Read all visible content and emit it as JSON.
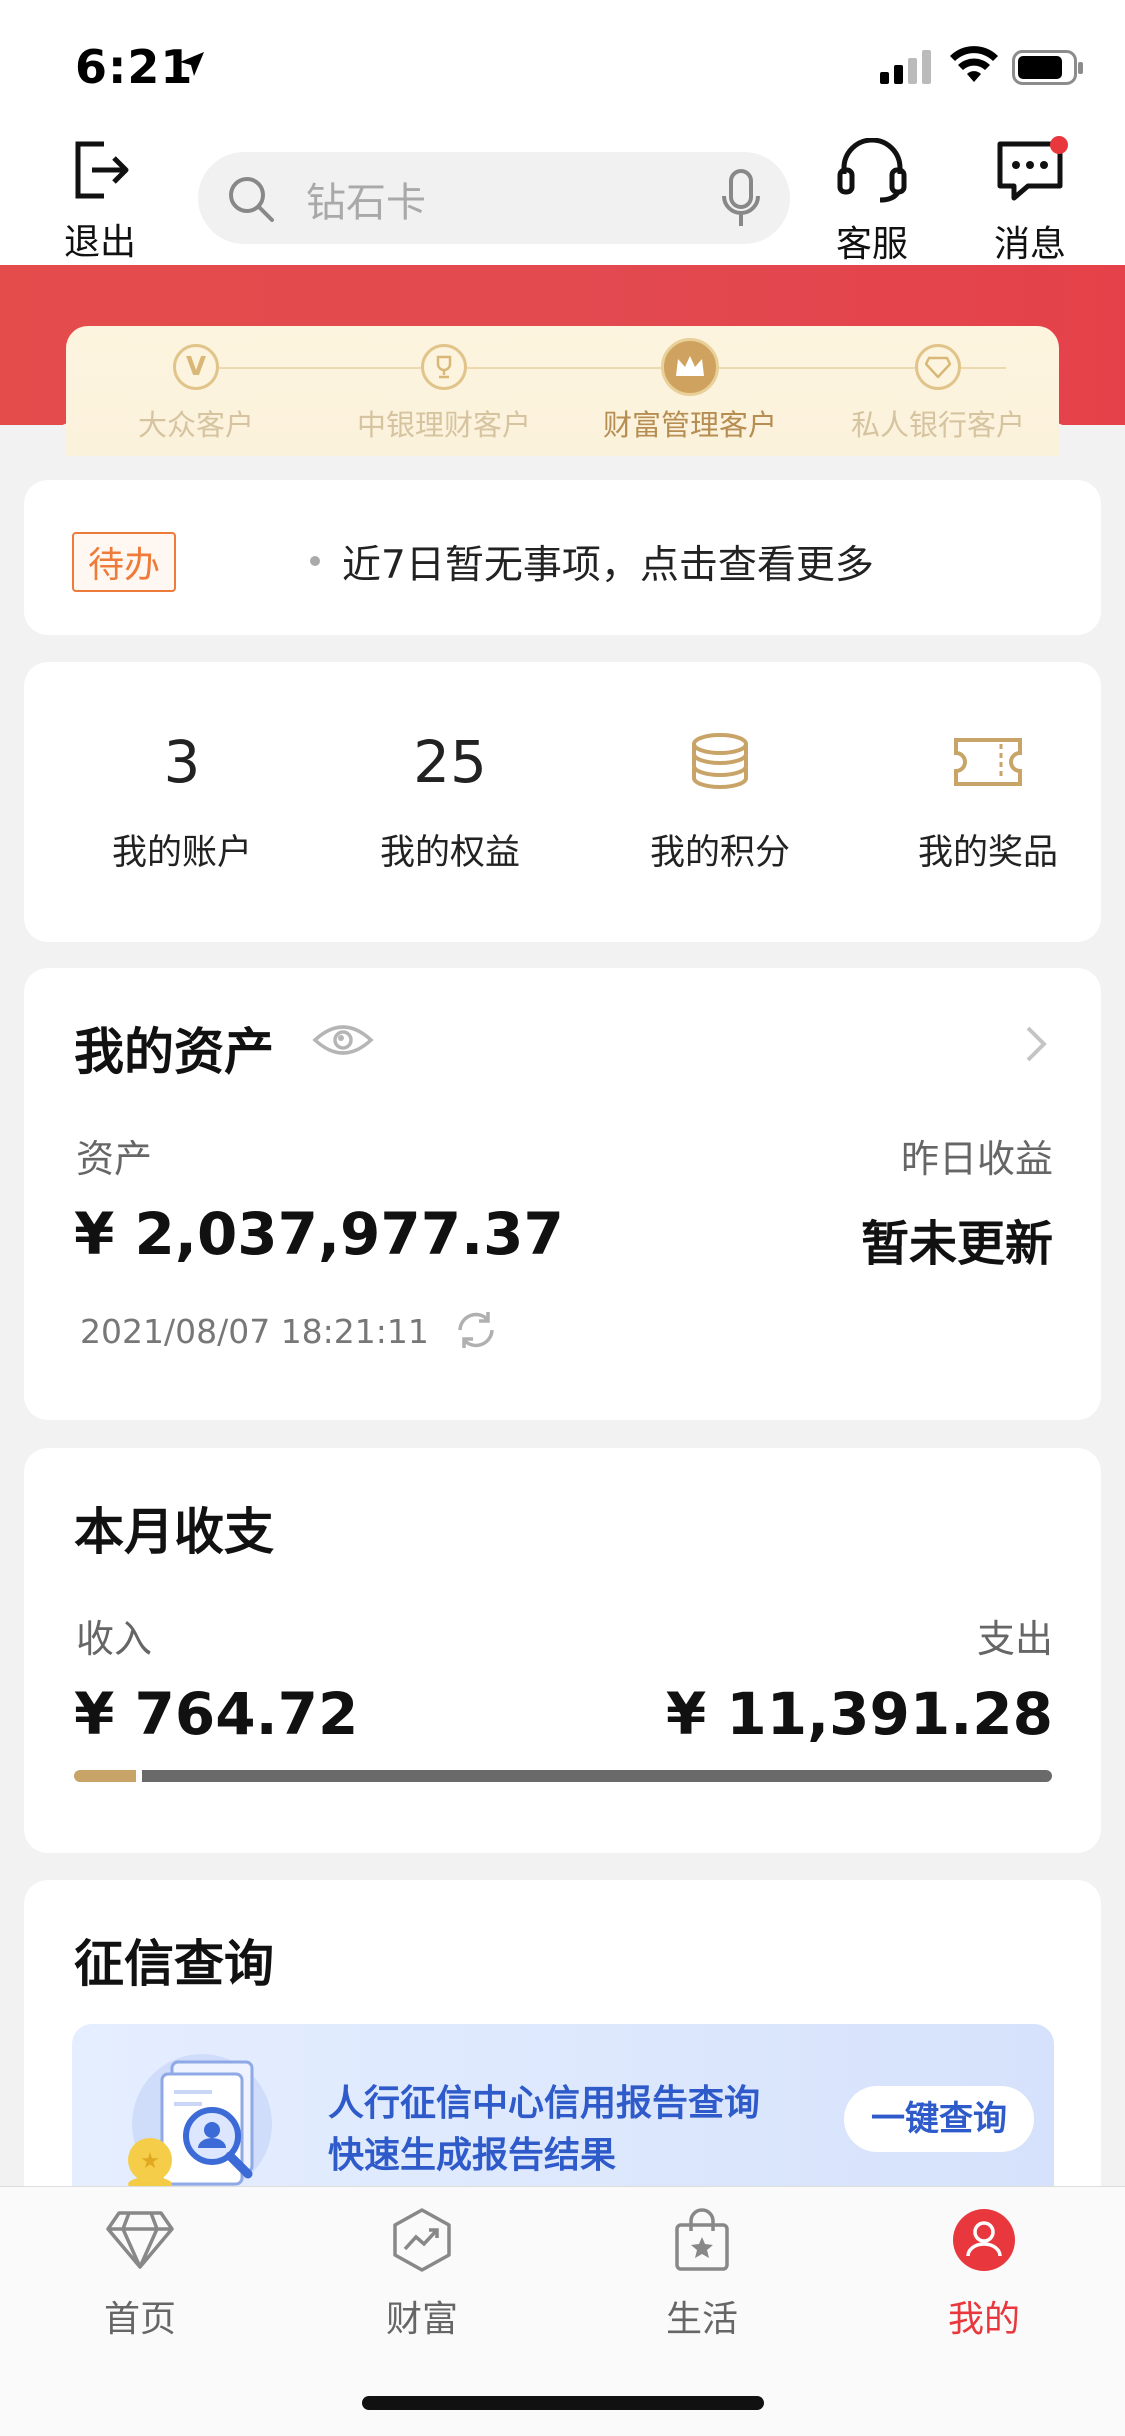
{
  "status_bar": {
    "time": "6:21"
  },
  "top_nav": {
    "exit_label": "退出",
    "search_placeholder": "钻石卡",
    "customer_service_label": "客服",
    "messages_label": "消息"
  },
  "tiers": [
    {
      "label": "大众客户",
      "active": false
    },
    {
      "label": "中银理财客户",
      "active": false
    },
    {
      "label": "财富管理客户",
      "active": true
    },
    {
      "label": "私人银行客户",
      "active": false
    }
  ],
  "todo": {
    "badge": "待办",
    "text": "近7日暂无事项，点击查看更多"
  },
  "quick": [
    {
      "value": "3",
      "label": "我的账户"
    },
    {
      "value": "25",
      "label": "我的权益"
    },
    {
      "icon": "coins-icon",
      "label": "我的积分"
    },
    {
      "icon": "ticket-icon",
      "label": "我的奖品"
    }
  ],
  "assets": {
    "title": "我的资产",
    "asset_label": "资产",
    "asset_value": "¥ 2,037,977.37",
    "yesterday_label": "昨日收益",
    "yesterday_value": "暂未更新",
    "updated_at": "2021/08/07 18:21:11"
  },
  "monthly": {
    "title": "本月收支",
    "income_label": "收入",
    "income_value": "¥ 764.72",
    "expense_label": "支出",
    "expense_value": "¥ 11,391.28",
    "income_ratio": 0.063
  },
  "credit": {
    "title": "征信查询",
    "line1": "人行征信中心信用报告查询",
    "line2": "快速生成报告结果",
    "button": "一键查询"
  },
  "tabs": [
    {
      "label": "首页",
      "icon": "diamond-icon"
    },
    {
      "label": "财富",
      "icon": "wealth-icon"
    },
    {
      "label": "生活",
      "icon": "shopping-bag-icon"
    },
    {
      "label": "我的",
      "icon": "profile-icon",
      "active": true
    }
  ],
  "colors": {
    "brand_red": "#e8383d",
    "gold": "#c9a468",
    "credit_blue": "#2e5bc9"
  }
}
